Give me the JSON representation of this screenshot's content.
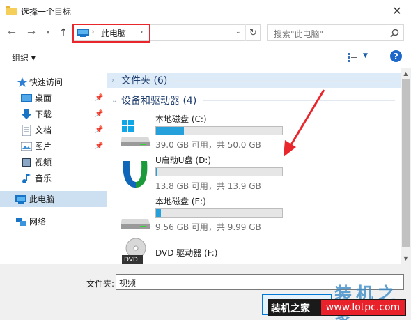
{
  "window": {
    "title": "选择一个目标",
    "close_glyph": "✕"
  },
  "address": {
    "location": "此电脑",
    "search_placeholder": "搜索\"此电脑\""
  },
  "toolbar": {
    "organize": "组织 ▾",
    "help": "?"
  },
  "navigation": {
    "items": [
      {
        "label": "快速访问",
        "icon": "star-icon"
      },
      {
        "label": "桌面",
        "icon": "desktop-icon",
        "pinned": true
      },
      {
        "label": "下载",
        "icon": "download-icon",
        "pinned": true
      },
      {
        "label": "文档",
        "icon": "documents-icon",
        "pinned": true
      },
      {
        "label": "图片",
        "icon": "pictures-icon",
        "pinned": true
      },
      {
        "label": "视频",
        "icon": "videos-icon"
      },
      {
        "label": "音乐",
        "icon": "music-icon"
      },
      {
        "label": "此电脑",
        "icon": "computer-icon",
        "selected": true
      },
      {
        "label": "网络",
        "icon": "network-icon"
      }
    ]
  },
  "content": {
    "folders_group": "文件夹 (6)",
    "devices_group": "设备和驱动器 (4)",
    "drives": [
      {
        "name": "本地磁盘 (C:)",
        "info": "39.0 GB 可用，共 50.0 GB",
        "used_fraction": 0.22,
        "icon": "hard-drive-icon"
      },
      {
        "name": "U启动U盘 (D:)",
        "info": "13.8 GB 可用，共 13.9 GB",
        "used_fraction": 0.01,
        "icon": "usb-drive-icon"
      },
      {
        "name": "本地磁盘 (E:)",
        "info": "9.56 GB 可用，共 9.99 GB",
        "used_fraction": 0.04,
        "icon": "hard-drive-icon"
      },
      {
        "name": "DVD 驱动器 (F:)",
        "info": "",
        "icon": "dvd-drive-icon"
      }
    ]
  },
  "footer": {
    "folder_label": "文件夹:",
    "folder_value": "视频"
  },
  "watermark": {
    "big": "装机之家",
    "badge_cn": "装机之家",
    "badge_url": "www.lotpc.com"
  },
  "colors": {
    "accent": "#26a0da",
    "highlight_red": "#e8262b",
    "selected_bg": "#cce0f2"
  }
}
